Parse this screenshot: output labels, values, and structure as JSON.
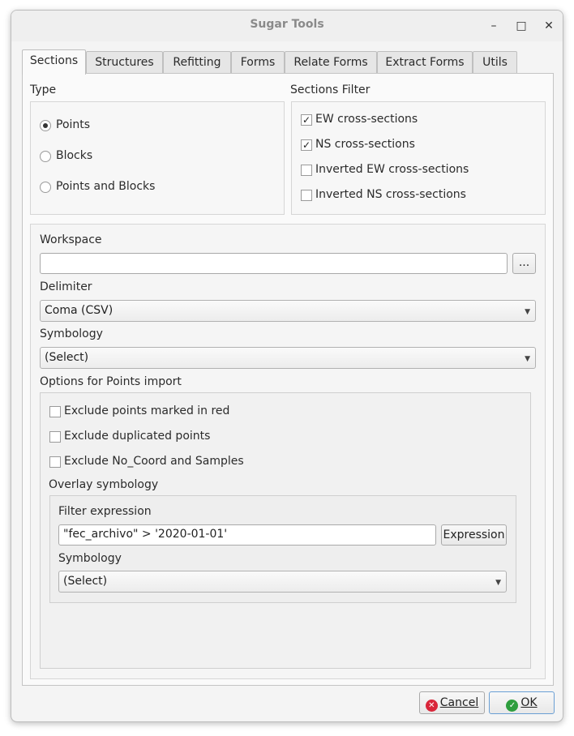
{
  "window": {
    "title": "Sugar Tools"
  },
  "tabs": [
    {
      "label": "Sections",
      "active": true
    },
    {
      "label": "Structures",
      "active": false
    },
    {
      "label": "Refitting",
      "active": false
    },
    {
      "label": "Forms",
      "active": false
    },
    {
      "label": "Relate Forms",
      "active": false
    },
    {
      "label": "Extract Forms",
      "active": false
    },
    {
      "label": "Utils",
      "active": false
    }
  ],
  "type_group": {
    "title": "Type",
    "options": [
      {
        "label": "Points",
        "selected": true
      },
      {
        "label": "Blocks",
        "selected": false
      },
      {
        "label": "Points and Blocks",
        "selected": false
      }
    ]
  },
  "filter_group": {
    "title": "Sections Filter",
    "options": [
      {
        "label": "EW cross-sections",
        "checked": true
      },
      {
        "label": "NS cross-sections",
        "checked": true
      },
      {
        "label": "Inverted EW cross-sections",
        "checked": false
      },
      {
        "label": "Inverted NS cross-sections",
        "checked": false
      }
    ]
  },
  "workspace": {
    "label": "Workspace",
    "value": "",
    "browse_label": "..."
  },
  "delimiter": {
    "label": "Delimiter",
    "value": "Coma (CSV)"
  },
  "symbology": {
    "label": "Symbology",
    "value": "(Select)"
  },
  "points_import": {
    "title": "Options for Points import",
    "options": [
      {
        "label": "Exclude points marked in red",
        "checked": false
      },
      {
        "label": "Exclude duplicated points",
        "checked": false
      },
      {
        "label": "Exclude No_Coord and Samples",
        "checked": false
      }
    ],
    "overlay": {
      "title": "Overlay symbology",
      "filter_label": "Filter expression",
      "filter_value": "\"fec_archivo\" > '2020-01-01'",
      "expression_button": "Expression",
      "symbology_label": "Symbology",
      "symbology_value": "(Select)"
    }
  },
  "footer": {
    "cancel_label": "Cancel",
    "ok_label": "OK"
  },
  "colors": {
    "cancel_icon": "#d9263a",
    "ok_icon": "#2e9e3e",
    "accent_border": "#6a9fd4"
  }
}
